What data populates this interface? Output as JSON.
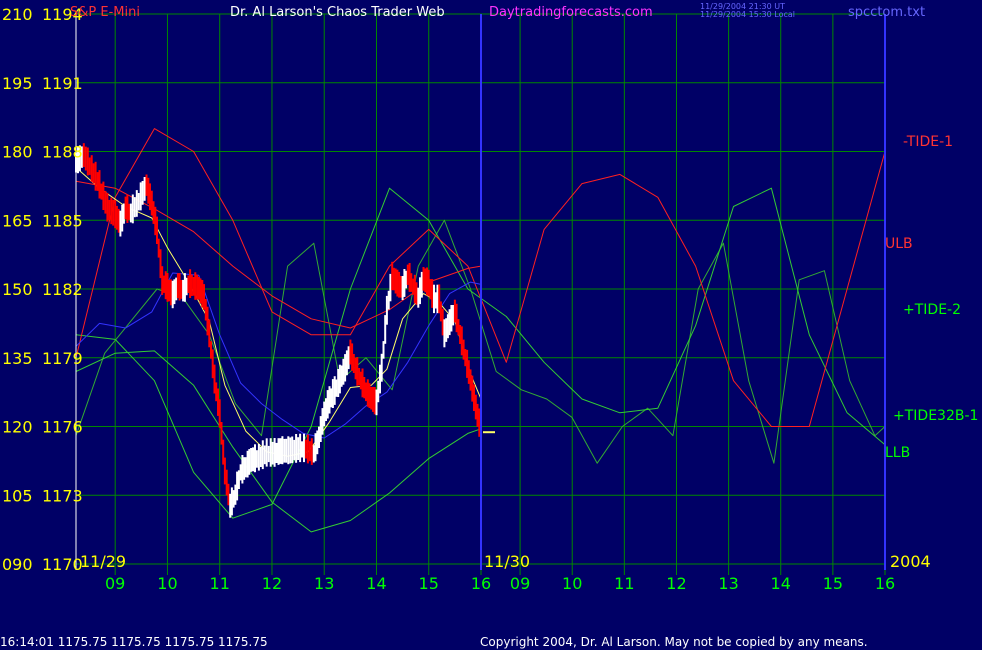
{
  "header": {
    "instrument": "S&P E-Mini",
    "site_name": "Dr. Al Larson's Chaos Trader Web",
    "site_url": "Daytradingforecasts.com",
    "timestamp_ut": "11/29/2004 21:30 UT",
    "timestamp_local": "11/29/2004 15:30 Local",
    "filename": "spcctom.txt"
  },
  "footer": {
    "quote": "16:14:01  1175.75 1175.75 1175.75 1175.75",
    "copyright": "Copyright 2004, Dr. Al Larson. May not be copied by any means."
  },
  "colors": {
    "background": "#000066",
    "grid": "#008800",
    "price_up": "#ffffff",
    "price_down": "#ff0000",
    "tide1": "#ff2020",
    "tide2": "#33cc33",
    "tide32b": "#33aa33",
    "band": "#3333ff",
    "avg": "#ffff66",
    "divider": "#3333ff",
    "label_yellow": "#ffff00",
    "label_green": "#00ff00",
    "label_red": "#ff3333",
    "label_magenta": "#ff33ff"
  },
  "chart_data": {
    "type": "line",
    "title": "S&P E-Mini",
    "y_left_ticks": [
      "210",
      "195",
      "180",
      "165",
      "150",
      "135",
      "120",
      "105",
      "090"
    ],
    "y_right_ticks": [
      "1194",
      "1191",
      "1188",
      "1185",
      "1182",
      "1179",
      "1176",
      "1173",
      "1170"
    ],
    "y_price_range": [
      1170,
      1194
    ],
    "y_tide_range": [
      90,
      210
    ],
    "x_range_hours": [
      8.25,
      16.0
    ],
    "x_ticks": [
      "09",
      "10",
      "11",
      "12",
      "13",
      "14",
      "15",
      "16",
      "09",
      "10",
      "11",
      "12",
      "13",
      "14",
      "15",
      "16"
    ],
    "date_labels": [
      "11/29",
      "11/30"
    ],
    "year_label": "2004",
    "legend_labels": [
      "-TIDE-1",
      "ULB",
      "+TIDE-2",
      "+TIDE32B-1",
      "LLB"
    ],
    "last_price": 1175.75,
    "series": [
      {
        "name": "price",
        "x": [
          8.25,
          8.4,
          8.55,
          8.7,
          8.85,
          9.0,
          9.1,
          9.2,
          9.3,
          9.45,
          9.6,
          9.7,
          9.8,
          9.9,
          10.0,
          10.1,
          10.2,
          10.3,
          10.4,
          10.5,
          10.6,
          10.7,
          10.8,
          10.9,
          11.0,
          11.1,
          11.2,
          11.3,
          11.4,
          11.5,
          11.6,
          11.75,
          11.9,
          12.05,
          12.2,
          12.35,
          12.5,
          12.65,
          12.8,
          12.9,
          13.0,
          13.1,
          13.2,
          13.3,
          13.4,
          13.5,
          13.6,
          13.7,
          13.8,
          13.9,
          14.0,
          14.1,
          14.2,
          14.3,
          14.4,
          14.5,
          14.6,
          14.7,
          14.8,
          14.9,
          15.0,
          15.1,
          15.2,
          15.3,
          15.4,
          15.5,
          15.6,
          15.7,
          15.8,
          15.9,
          16.0
        ],
        "y": [
          1187.5,
          1187.8,
          1187.2,
          1186.5,
          1185.5,
          1185.2,
          1184.8,
          1185.5,
          1185.3,
          1185.8,
          1186.5,
          1185.7,
          1184.5,
          1182.3,
          1182.0,
          1181.7,
          1182.1,
          1181.9,
          1182.2,
          1182.1,
          1182.0,
          1181.6,
          1180.0,
          1178.0,
          1176.5,
          1174.0,
          1172.5,
          1173.0,
          1174.0,
          1174.2,
          1174.5,
          1174.6,
          1174.8,
          1174.8,
          1174.9,
          1174.9,
          1175.0,
          1175.0,
          1174.8,
          1175.5,
          1176.5,
          1177.1,
          1177.5,
          1178.0,
          1178.5,
          1179.2,
          1178.5,
          1178.0,
          1177.5,
          1177.2,
          1177.0,
          1178.5,
          1181.0,
          1182.5,
          1182.2,
          1182.0,
          1182.6,
          1182.1,
          1181.6,
          1182.4,
          1182.2,
          1181.5,
          1181.5,
          1180.0,
          1180.5,
          1181.0,
          1180.0,
          1179.0,
          1178.0,
          1176.8,
          1175.75
        ]
      },
      {
        "name": "-TIDE-1",
        "x": [
          8.25,
          9.0,
          9.75,
          10.5,
          11.25,
          12.0,
          12.75,
          13.5,
          14.25,
          15.0,
          15.75,
          16.5,
          17.25,
          18.0,
          18.75,
          19.5,
          20.25,
          21.0,
          21.75,
          22.5,
          23.25,
          24.0
        ],
        "y": [
          135,
          170,
          185,
          180,
          165,
          145,
          140,
          140,
          155,
          163,
          155,
          134,
          163,
          173,
          175,
          170,
          155,
          130,
          120,
          120,
          150,
          180
        ]
      },
      {
        "name": "+TIDE-2",
        "x": [
          8.25,
          9.0,
          9.75,
          10.5,
          11.25,
          12.0,
          12.75,
          13.5,
          14.25,
          15.0,
          15.75,
          16.5,
          17.25,
          18.0,
          18.75,
          19.5,
          20.25,
          21.0,
          21.75,
          22.5,
          23.25,
          24.0
        ],
        "y": [
          140,
          139,
          130,
          110,
          100,
          103,
          120,
          150,
          172,
          165,
          150,
          144,
          134,
          126,
          123,
          124,
          142,
          168,
          172,
          140,
          123,
          116
        ]
      },
      {
        "name": "+TIDE32B-1",
        "x": [
          8.25,
          8.8,
          9.3,
          9.8,
          10.3,
          10.8,
          11.3,
          11.8,
          12.3,
          12.8,
          13.3,
          13.8,
          14.3,
          14.8,
          15.3,
          15.8,
          16.3,
          16.8,
          17.3,
          17.8,
          18.3,
          18.8,
          19.3,
          19.8,
          20.3,
          20.8,
          21.3,
          21.8,
          22.3,
          22.8,
          23.3,
          23.8,
          24.0
        ],
        "y": [
          118,
          136,
          143,
          150,
          148,
          140,
          125,
          118,
          155,
          160,
          130,
          135,
          128,
          155,
          165,
          150,
          132,
          128,
          126,
          122,
          112,
          120,
          124,
          118,
          150,
          160,
          130,
          112,
          152,
          154,
          130,
          118,
          120
        ]
      },
      {
        "name": "ULB",
        "x": [
          8.25,
          9.0,
          9.75,
          10.5,
          11.25,
          12.0,
          12.75,
          13.5,
          14.25,
          15.0,
          15.75,
          16.0
        ],
        "y": [
          1186.7,
          1186.4,
          1185.5,
          1184.5,
          1183.0,
          1181.7,
          1180.7,
          1180.3,
          1181.1,
          1182.3,
          1182.9,
          1183.0
        ]
      },
      {
        "name": "LLB",
        "x": [
          8.25,
          9.0,
          9.75,
          10.5,
          11.25,
          12.0,
          12.75,
          13.5,
          14.25,
          15.0,
          15.75,
          16.0
        ],
        "y": [
          1178.4,
          1179.2,
          1179.3,
          1177.8,
          1175.1,
          1172.7,
          1171.4,
          1171.9,
          1173.1,
          1174.6,
          1175.7,
          1175.9
        ]
      },
      {
        "name": "average",
        "x": [
          8.25,
          8.7,
          9.2,
          9.7,
          10.0,
          10.4,
          10.8,
          11.1,
          11.5,
          11.9,
          12.3,
          12.7,
          13.1,
          13.5,
          13.9,
          14.2,
          14.5,
          14.9,
          15.2,
          15.5,
          15.8,
          16.0
        ],
        "y": [
          1187.3,
          1186.4,
          1185.6,
          1185.1,
          1183.8,
          1182.3,
          1180.6,
          1177.8,
          1175.8,
          1174.9,
          1174.7,
          1174.9,
          1176.2,
          1177.7,
          1177.8,
          1178.5,
          1180.7,
          1181.8,
          1181.4,
          1180.6,
          1178.3,
          1177.2
        ]
      },
      {
        "name": "band",
        "x": [
          8.25,
          8.7,
          9.2,
          9.7,
          10.1,
          10.6,
          11.0,
          11.4,
          11.8,
          12.2,
          12.6,
          13.0,
          13.4,
          13.8,
          14.2,
          14.6,
          15.0,
          15.4,
          15.8,
          16.0
        ],
        "y": [
          1179.5,
          1180.5,
          1180.3,
          1181.0,
          1182.7,
          1182.6,
          1180.0,
          1177.9,
          1177.0,
          1176.3,
          1175.7,
          1175.5,
          1176.1,
          1176.9,
          1177.5,
          1178.8,
          1180.4,
          1181.8,
          1182.3,
          1182.2
        ]
      }
    ]
  }
}
